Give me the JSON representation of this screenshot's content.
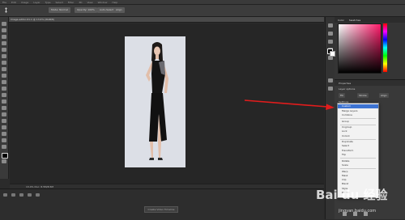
{
  "menu": [
    "File",
    "Edit",
    "Image",
    "Layer",
    "Type",
    "Select",
    "Filter",
    "3D",
    "View",
    "Window",
    "Help"
  ],
  "options": {
    "mode_label": "Mode: Normal",
    "opacity_label": "Opacity: 100%",
    "auto_label": "Auto-Select",
    "align_label": "Align"
  },
  "document": {
    "tab": "Image-editor-01.1 @ 13.4% (RGB/8)",
    "status": "13.4%  Doc: 8.5M/8.5M"
  },
  "timeline": {
    "create_label": "Create Video Timeline"
  },
  "color_panel": {
    "tab_color": "Color",
    "tab_swatches": "Swatches"
  },
  "properties": {
    "title": "Properties",
    "row1": "Layer options",
    "btn1": "Fill",
    "btn2": "Stroke",
    "btn3": "Align",
    "row2": "Settings"
  },
  "dropdown": {
    "items": [
      "Custom",
      "Merge Layers",
      "Combine",
      "Group",
      "Ungroup",
      "Lock",
      "Unlock",
      "Duplicate",
      "Select",
      "Transform",
      "Flip",
      "Rotate",
      "Scale",
      "Warp",
      "Mask",
      "Clip",
      "Blend",
      "Style",
      "Export",
      "Copy",
      "Paste",
      "Clear"
    ],
    "selected": 0
  },
  "watermark": {
    "logo": "Bai du 经验",
    "url": "jingyan.baidu.com"
  }
}
